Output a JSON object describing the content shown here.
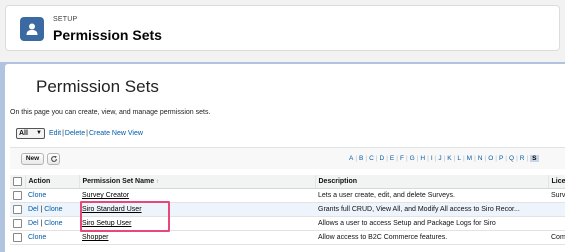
{
  "header": {
    "kicker": "SETUP",
    "title": "Permission Sets"
  },
  "page": {
    "title": "Permission Sets",
    "description": "On this page you can create, view, and manage permission sets."
  },
  "views": {
    "selected": "All",
    "edit": "Edit",
    "delete": "Delete",
    "create": "Create New View"
  },
  "toolbar": {
    "new_label": "New",
    "letters": [
      "A",
      "B",
      "C",
      "D",
      "E",
      "F",
      "G",
      "H",
      "I",
      "J",
      "K",
      "L",
      "M",
      "N",
      "O",
      "P",
      "Q",
      "R",
      "S"
    ],
    "selected_letter": "S"
  },
  "table": {
    "headers": {
      "action": "Action",
      "name": "Permission Set Name",
      "sort": "↑",
      "description": "Description",
      "license": "Licen"
    },
    "rows": [
      {
        "del": "",
        "clone": "Clone",
        "name": "Survey Creator",
        "description": "Lets a user create, edit, and delete Surveys.",
        "license": "Surv"
      },
      {
        "del": "Del",
        "clone": "Clone",
        "name": "Siro Standard User",
        "description": "Grants full CRUD, View All, and Modify All access to Siro Recor...",
        "license": ""
      },
      {
        "del": "Del",
        "clone": "Clone",
        "name": "Siro Setup User",
        "description": "Allows a user to access Setup and Package Logs for Siro",
        "license": ""
      },
      {
        "del": "",
        "clone": "Clone",
        "name": "Shopper",
        "description": "Allow access to B2C Commerce features.",
        "license": "Com"
      }
    ]
  },
  "colors": {
    "link": "#015ba7",
    "highlight_box": "#e8477a",
    "header_icon": "#3b6aa3",
    "backdrop": "#b0c4df"
  }
}
